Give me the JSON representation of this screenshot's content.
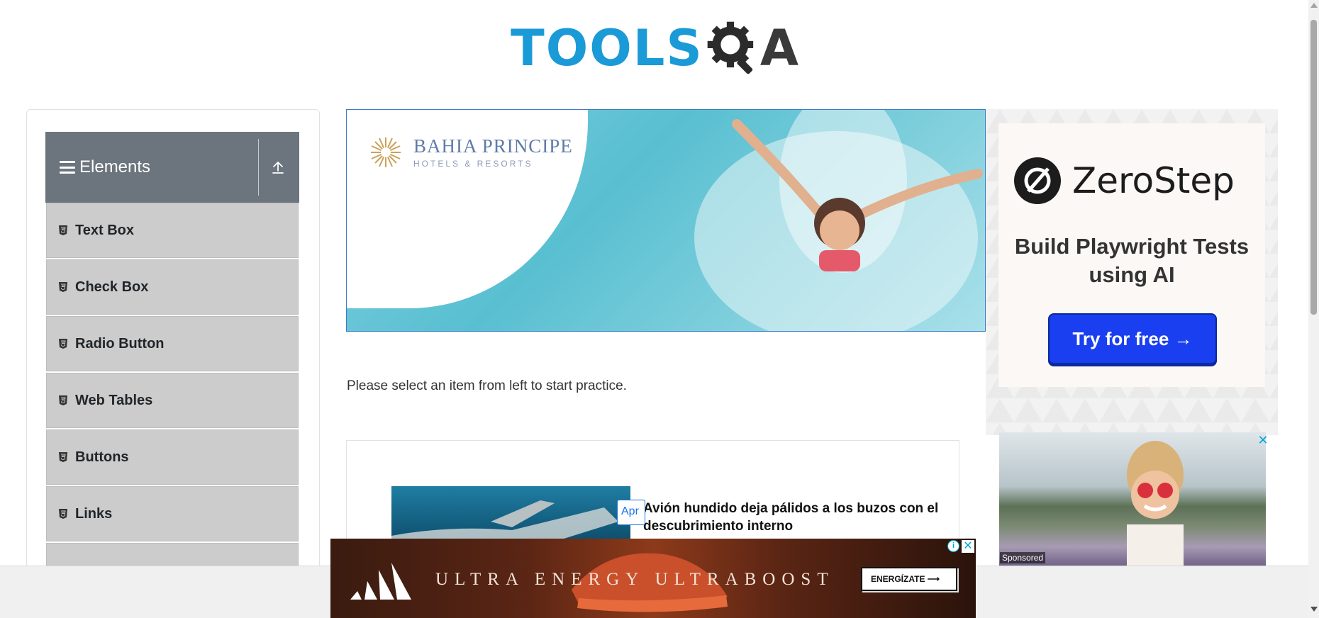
{
  "header": {
    "logo_text_left": "TOOLS",
    "logo_text_right": "A"
  },
  "sidebar": {
    "group_title": "Elements",
    "items": [
      {
        "label": "Text Box"
      },
      {
        "label": "Check Box"
      },
      {
        "label": "Radio Button"
      },
      {
        "label": "Web Tables"
      },
      {
        "label": "Buttons"
      },
      {
        "label": "Links"
      },
      {
        "label": ""
      }
    ]
  },
  "banner_ad": {
    "brand_name": "BAHIA PRINCIPE",
    "brand_sub": "HOTELS & RESORTS"
  },
  "main": {
    "intro_text": "Please select an item from left to start practice."
  },
  "article": {
    "title": "Avión hundido deja pálidos a los buzos con el descubrimiento interno",
    "button_label": "Apr"
  },
  "right_ad": {
    "brand": "ZeroStep",
    "tagline": "Build Playwright Tests using AI",
    "cta": "Try for free →"
  },
  "side_ad": {
    "close_label": "✕",
    "sponsored": "Sponsored"
  },
  "bottom_ad": {
    "text": "ULTRA ENERGY   ULTRABOOST",
    "cta": "ENERGÍZATE ⟶",
    "info_label": "i",
    "close_label": "✕"
  },
  "colors": {
    "brand_blue": "#1a9ad6",
    "sidebar_header": "#6c757d",
    "menu_item": "#cccccc",
    "cta_blue": "#1a3ff0"
  }
}
